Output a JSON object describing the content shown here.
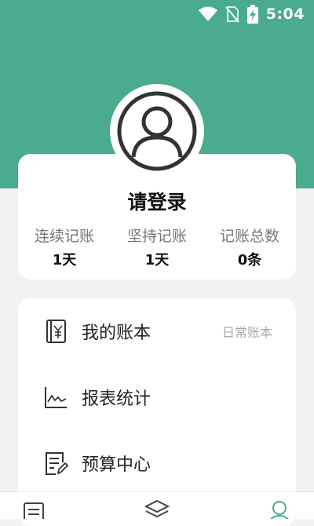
{
  "status_bar": {
    "time": "5:04",
    "icons": [
      "wifi-icon",
      "no-sim-icon",
      "battery-charging-icon"
    ]
  },
  "colors": {
    "accent": "#4aab8e",
    "card_bg": "#ffffff",
    "page_bg": "#f2f2f2"
  },
  "profile": {
    "avatar_icon": "user-avatar-icon",
    "login_text": "请登录",
    "stats": [
      {
        "label": "连续记账",
        "value": "1天"
      },
      {
        "label": "坚持记账",
        "value": "1天"
      },
      {
        "label": "记账总数",
        "value": "0条"
      }
    ]
  },
  "menu": {
    "items": [
      {
        "icon": "ledger-icon",
        "label": "我的账本",
        "extra": "日常账本"
      },
      {
        "icon": "chart-icon",
        "label": "报表统计"
      },
      {
        "icon": "budget-icon",
        "label": "预算中心"
      }
    ]
  },
  "bottom_nav": {
    "items": [
      {
        "icon": "list-icon"
      },
      {
        "icon": "layers-icon"
      },
      {
        "icon": "profile-icon"
      }
    ]
  }
}
